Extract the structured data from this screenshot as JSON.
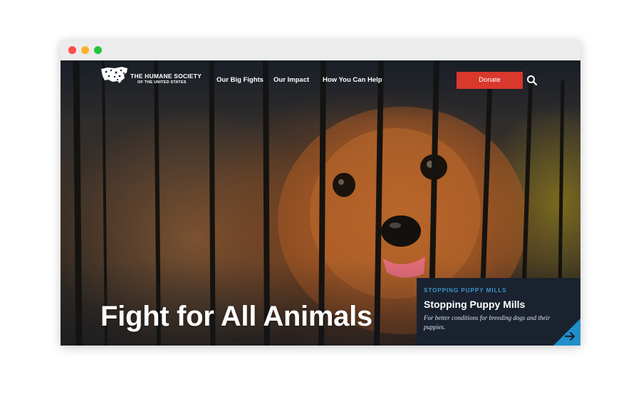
{
  "window": {
    "controls": [
      "close",
      "minimize",
      "maximize"
    ]
  },
  "nav": {
    "logo_line1": "THE HUMANE SOCIETY",
    "logo_line2": "OF THE UNITED STATES",
    "links": [
      "Our Big Fights",
      "Our Impact",
      "How You Can Help"
    ],
    "donate_label": "Donate",
    "search_icon": "magnifier-icon"
  },
  "hero": {
    "headline": "Fight for All Animals",
    "image": "dog-behind-cage-bars"
  },
  "feature": {
    "kicker": "STOPPING PUPPY MILLS",
    "title": "Stopping Puppy Mills",
    "description": "For better conditions for breeding dogs and their puppies.",
    "arrow_icon": "arrow-right-icon"
  },
  "colors": {
    "donate": "#d9382c",
    "kicker": "#3a99cc",
    "card_bg": "#1a2230",
    "arrow_tab": "#1f8fcb"
  }
}
